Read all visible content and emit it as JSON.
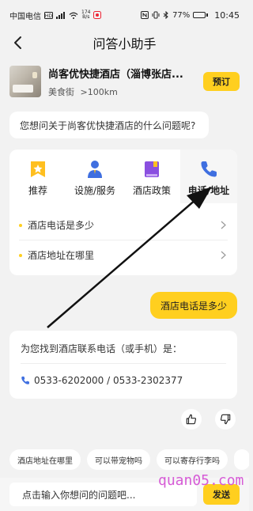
{
  "status_bar": {
    "carrier": "中国电信",
    "network_speed_value": "174",
    "network_speed_unit": "B/s",
    "battery_percent": "77%",
    "battery_level": 0.77,
    "time": "10:45"
  },
  "nav": {
    "title": "问答小助手"
  },
  "hotel": {
    "name": "尚客优快捷酒店（淄博张店...",
    "category": "美食街",
    "distance": ">100km",
    "book_label": "预订"
  },
  "assistant_prompt": "您想问关于尚客优快捷酒店的什么问题呢?",
  "menu": {
    "items": [
      {
        "label": "推荐",
        "icon": "star-badge-icon",
        "color": "#ffbf1f"
      },
      {
        "label": "设施/服务",
        "icon": "concierge-icon",
        "color": "#3f6fe0"
      },
      {
        "label": "酒店政策",
        "icon": "policy-book-icon",
        "color": "#8a4fe0"
      },
      {
        "label": "电话/地址",
        "icon": "phone-icon",
        "color": "#3f6fe0"
      }
    ],
    "questions": [
      {
        "label": "酒店电话是多少"
      },
      {
        "label": "酒店地址在哪里"
      }
    ]
  },
  "user_message": "酒店电话是多少",
  "answer": {
    "intro": "为您找到酒店联系电话（或手机）是：",
    "phones": "0533-6202000 / 0533-2302377"
  },
  "chips": [
    {
      "label": "酒店地址在哪里"
    },
    {
      "label": "可以带宠物吗"
    },
    {
      "label": "可以寄存行李吗"
    }
  ],
  "input": {
    "placeholder": "点击输入你想问的问题吧...",
    "send_label": "发送"
  },
  "watermark": "quan05.com",
  "colors": {
    "accent": "#ffcf1f",
    "background": "#f2f2f2"
  }
}
